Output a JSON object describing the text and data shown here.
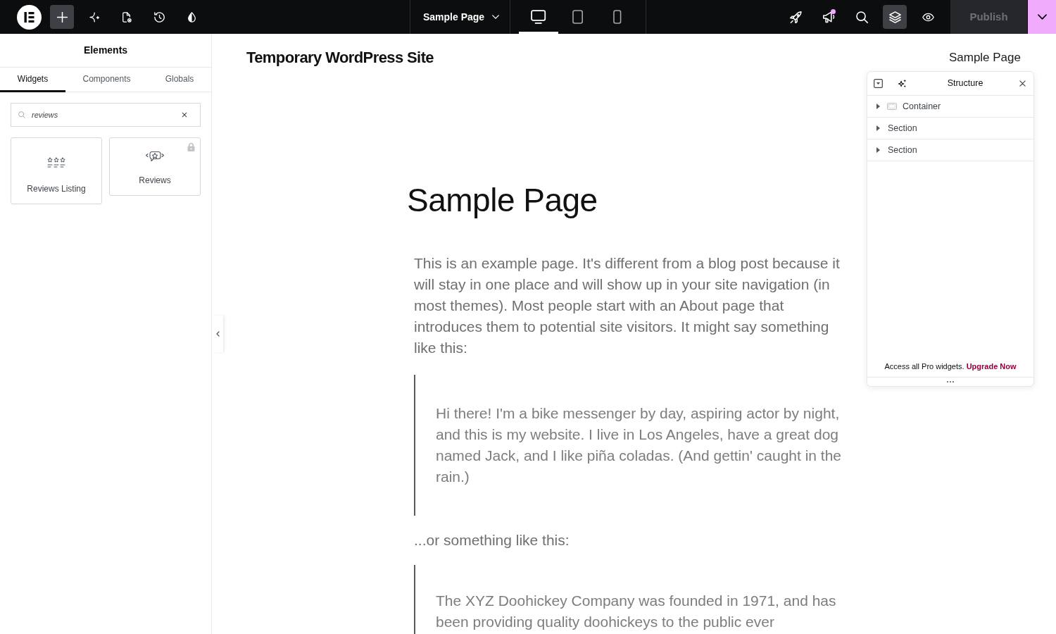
{
  "top_bar": {
    "left_tools": [
      {
        "kind": "add",
        "selected": true
      },
      {
        "kind": "ai",
        "selected": false
      },
      {
        "kind": "page_settings",
        "selected": false
      },
      {
        "kind": "history",
        "selected": false
      },
      {
        "kind": "theme",
        "selected": false
      }
    ],
    "page_selector": {
      "label": "Sample Page"
    },
    "devices": [
      {
        "kind": "desktop",
        "selected": true
      },
      {
        "kind": "tablet",
        "selected": false
      },
      {
        "kind": "mobile",
        "selected": false
      }
    ],
    "right_tools": [
      {
        "kind": "launch",
        "selected": false,
        "unread": false
      },
      {
        "kind": "announcements",
        "selected": false,
        "unread": true
      },
      {
        "kind": "search",
        "selected": false,
        "unread": false
      },
      {
        "kind": "structure",
        "selected": true,
        "unread": false
      },
      {
        "kind": "preview",
        "selected": false,
        "unread": false
      }
    ],
    "publish": {
      "label": "Publish",
      "disabled": true
    }
  },
  "elements_panel": {
    "title": "Elements",
    "tabs": [
      {
        "label": "Widgets",
        "selected": true
      },
      {
        "label": "Components",
        "selected": false
      },
      {
        "label": "Globals",
        "selected": false
      }
    ],
    "search": {
      "value": "reviews"
    },
    "widgets": [
      {
        "kind": "reviews_listing",
        "label": "Reviews Listing",
        "locked": false
      },
      {
        "kind": "reviews",
        "label": "Reviews",
        "locked": true
      }
    ]
  },
  "canvas": {
    "site_title": "Temporary WordPress Site",
    "nav": [
      {
        "label": "Sample Page"
      }
    ],
    "heading": "Sample Page",
    "blocks": [
      {
        "kind": "paragraph",
        "text": "This is an example page. It's different from a blog post because it will stay in one place and will show up in your site navigation (in most themes). Most people start with an About page that introduces them to potential site visitors. It might say something like this:"
      },
      {
        "kind": "quote",
        "text": "Hi there! I'm a bike messenger by day, aspiring actor by night, and this is my website. I live in Los Angeles, have a great dog named Jack, and I like piña coladas. (And gettin' caught in the rain.)"
      },
      {
        "kind": "paragraph",
        "text": "...or something like this:"
      },
      {
        "kind": "quote",
        "text": "The XYZ Doohickey Company was founded in 1971, and has been providing quality doohickeys to the public ever"
      }
    ]
  },
  "structure_panel": {
    "title": "Structure",
    "items": [
      {
        "kind": "container",
        "label": "Container",
        "expanded": false
      },
      {
        "kind": "section",
        "label": "Section",
        "expanded": false
      },
      {
        "kind": "section",
        "label": "Section",
        "expanded": false
      }
    ],
    "footer": {
      "text": "Access all Pro widgets.",
      "link": "Upgrade Now"
    }
  }
}
